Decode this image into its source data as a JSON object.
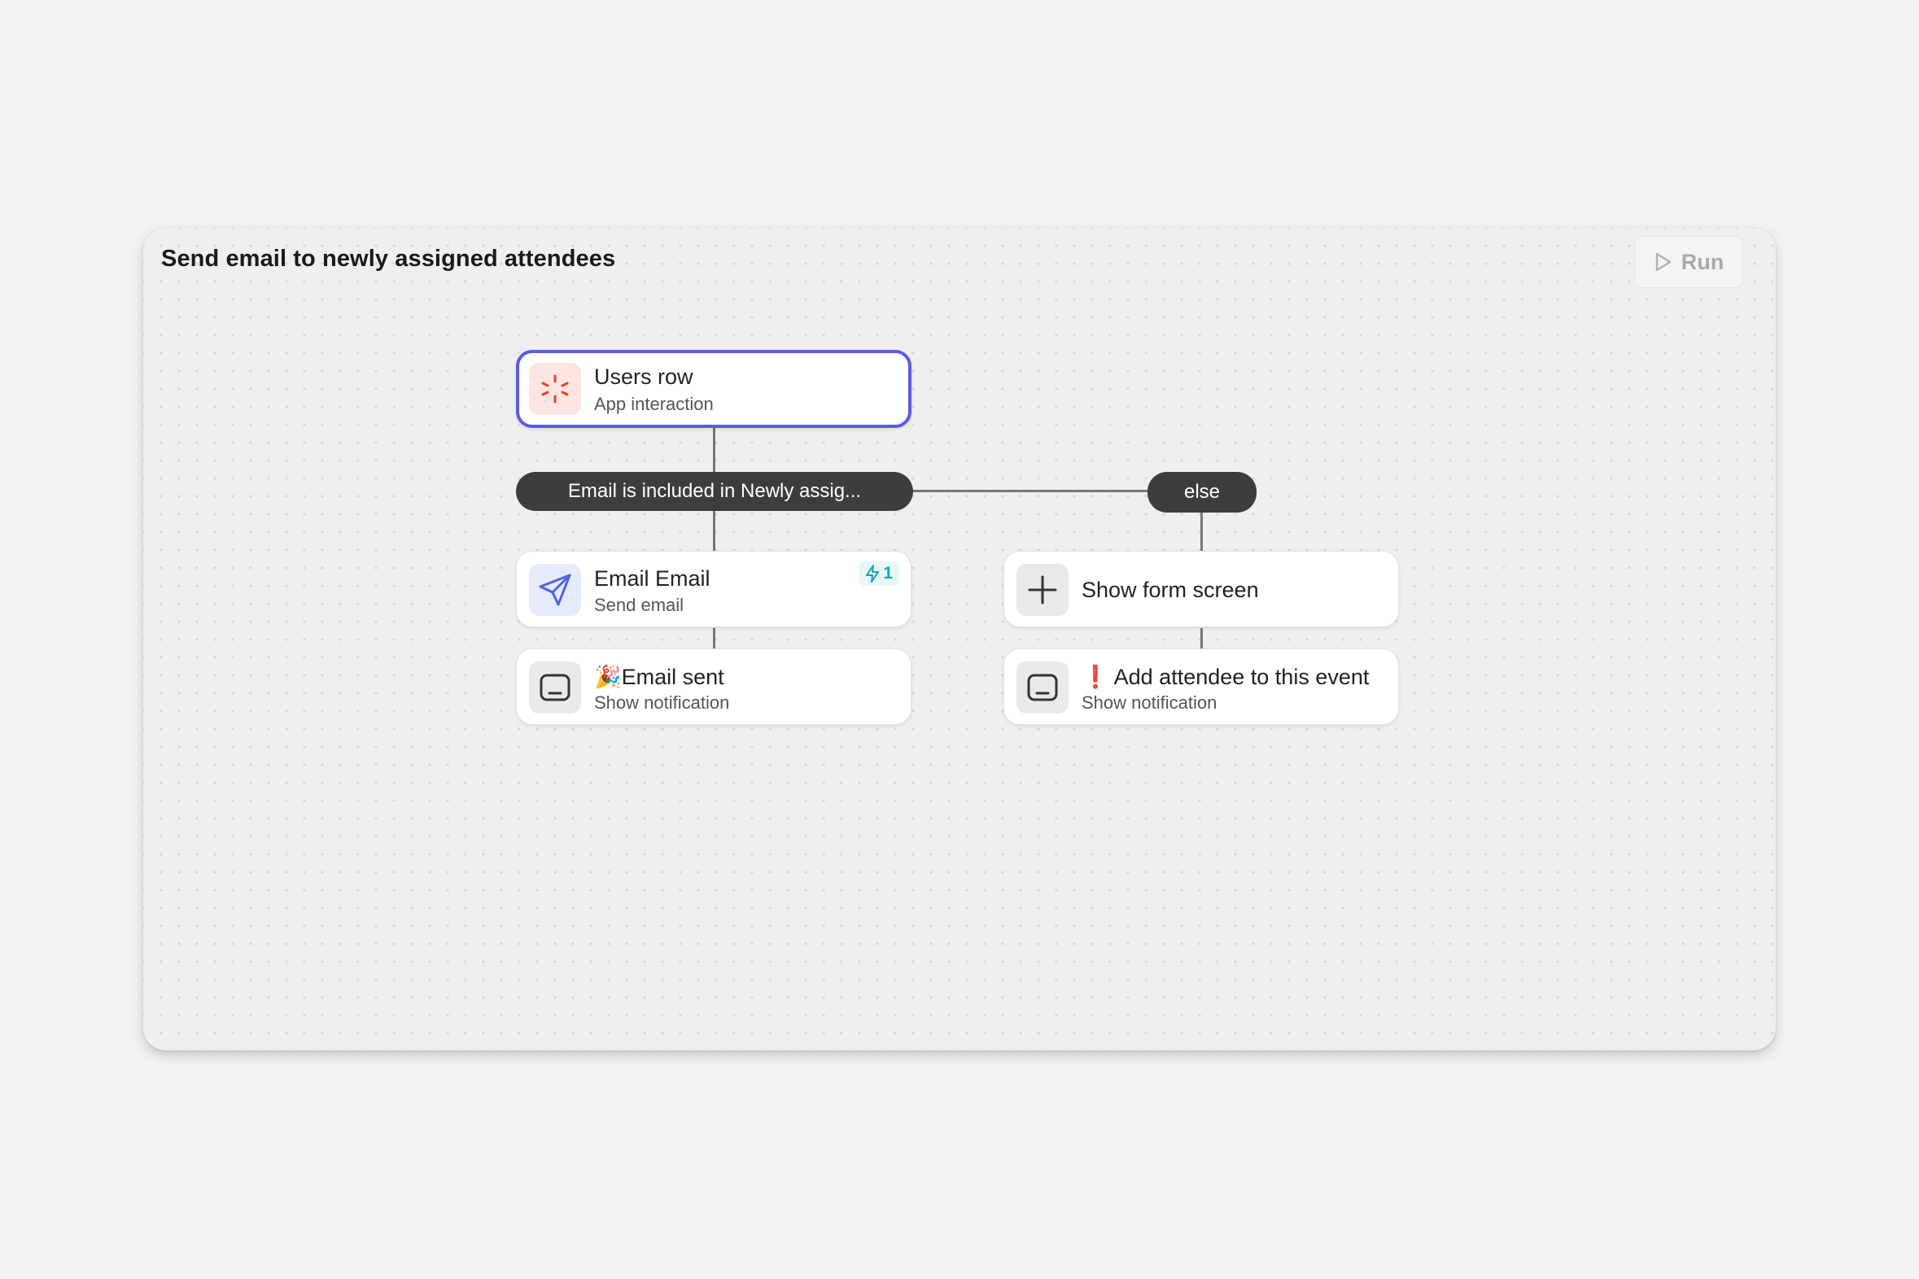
{
  "workflow": {
    "title": "Send email to newly assigned attendees",
    "run_label": "Run"
  },
  "trigger": {
    "title": "Users row",
    "subtitle": "App interaction",
    "icon": "spark-icon",
    "accent": "#e8452c"
  },
  "branch": {
    "condition": "Email is included in Newly assig...",
    "else_label": "else"
  },
  "left_steps": [
    {
      "title": "Email Email",
      "subtitle": "Send email",
      "icon": "send-icon",
      "badge": "1"
    },
    {
      "emoji": "🎉",
      "title": "Email sent",
      "subtitle": "Show notification",
      "icon": "notification-icon"
    }
  ],
  "right_steps": [
    {
      "title": "Show form screen",
      "icon": "plus-icon"
    },
    {
      "emoji": "❗",
      "title": "Add attendee to this event",
      "subtitle": "Show notification",
      "icon": "notification-icon"
    }
  ],
  "colors": {
    "selection": "#5b5ce6",
    "pill": "#3d3d3d",
    "badge": "#1aa3b0",
    "send_icon": "#4f63e6"
  }
}
